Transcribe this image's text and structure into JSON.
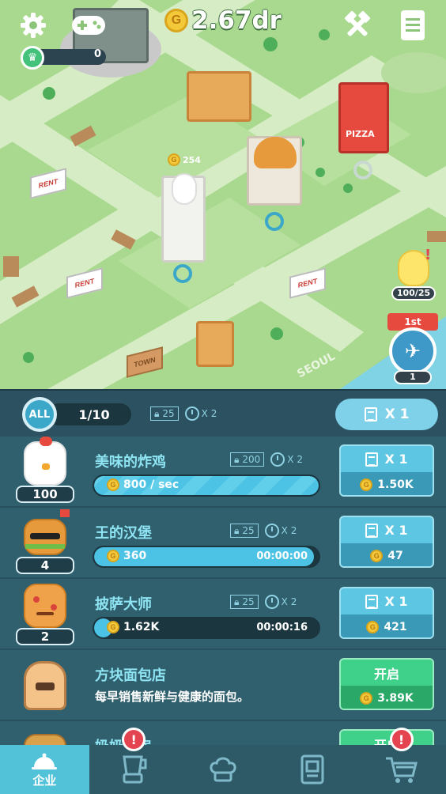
{
  "hud": {
    "money": "2.67dr",
    "crown_value": "0",
    "coin_symbol": "G"
  },
  "map": {
    "rent_label": "RENT",
    "town_label": "TOWN",
    "seoul_label": "SEOUL",
    "pizza_label": "PIZZA",
    "coin_float": "254",
    "egg_counter": "100/25",
    "rank_label": "1st",
    "rank_count": "1"
  },
  "panel": {
    "all_label": "ALL",
    "progress": "1/10",
    "capacity": "25",
    "speed": "X 2",
    "buy_multiplier": "X 1"
  },
  "businesses": [
    {
      "name": "美味的炸鸡",
      "level": "100",
      "capacity": "200",
      "speed": "X 2",
      "income": "800 / sec",
      "timer": "",
      "progress": 1.0,
      "multiplier": "X 1",
      "cost": "1.50K"
    },
    {
      "name": "王的汉堡",
      "level": "4",
      "capacity": "25",
      "speed": "X 2",
      "income": "360",
      "timer": "00:00:00",
      "progress": 0.98,
      "multiplier": "X 1",
      "cost": "47"
    },
    {
      "name": "披萨大师",
      "level": "2",
      "capacity": "25",
      "speed": "X 2",
      "income": "1.62K",
      "timer": "00:00:16",
      "progress": 0.08,
      "multiplier": "X 1",
      "cost": "421"
    },
    {
      "name": "方块面包店",
      "description": "每早销售新鲜与健康的面包。",
      "open_label": "开启",
      "cost": "3.89K"
    },
    {
      "name": "奶奶厨房",
      "open_label": "开启"
    }
  ],
  "nav": {
    "items": [
      {
        "label": "企业",
        "icon": "cloche-icon"
      },
      {
        "label": "",
        "icon": "blender-icon"
      },
      {
        "label": "",
        "icon": "chef-hat-icon"
      },
      {
        "label": "",
        "icon": "menu-book-icon"
      },
      {
        "label": "",
        "icon": "cart-icon"
      }
    ],
    "alert_symbol": "!"
  },
  "colors": {
    "panel_bg": "#30606e",
    "accent_blue": "#5cc6e3",
    "accent_green": "#3fd08a",
    "alert_red": "#e44450"
  }
}
